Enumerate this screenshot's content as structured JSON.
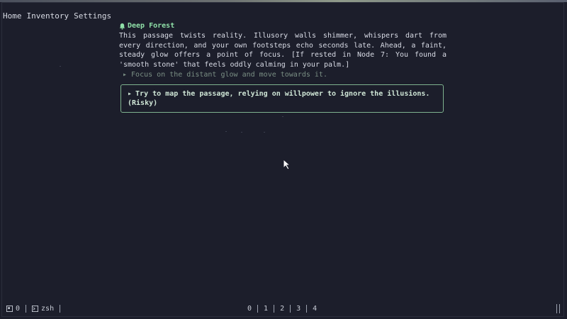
{
  "nav": {
    "items": [
      "Home",
      "Inventory",
      "Settings"
    ]
  },
  "scene": {
    "title": "Deep Forest",
    "title_icon": "bell-icon",
    "passage": "This passage twists reality. Illusory walls shimmer, whispers dart from every direction, and your own footsteps echo seconds late. Ahead, a faint, steady glow offers a point of focus. [If rested in Node 7: You found a 'smooth stone' that feels oddly calming in your palm.]"
  },
  "choices": [
    {
      "marker": "▸",
      "label": "Focus on the distant glow and move towards it."
    },
    {
      "marker": "▸",
      "label": "Try to map the passage, relying on willpower to ignore the illusions. (Risky)"
    }
  ],
  "statusbar": {
    "session_icon": "session-icon",
    "session": "0",
    "terminal_icon": "terminal-icon",
    "shell": "zsh",
    "workspaces": [
      "0",
      "1",
      "2",
      "3",
      "4"
    ]
  },
  "colors": {
    "background": "#1c1e2b",
    "accent": "#8fe0a8",
    "choice_border": "#7fb38f",
    "muted_choice": "#7a8f84"
  }
}
